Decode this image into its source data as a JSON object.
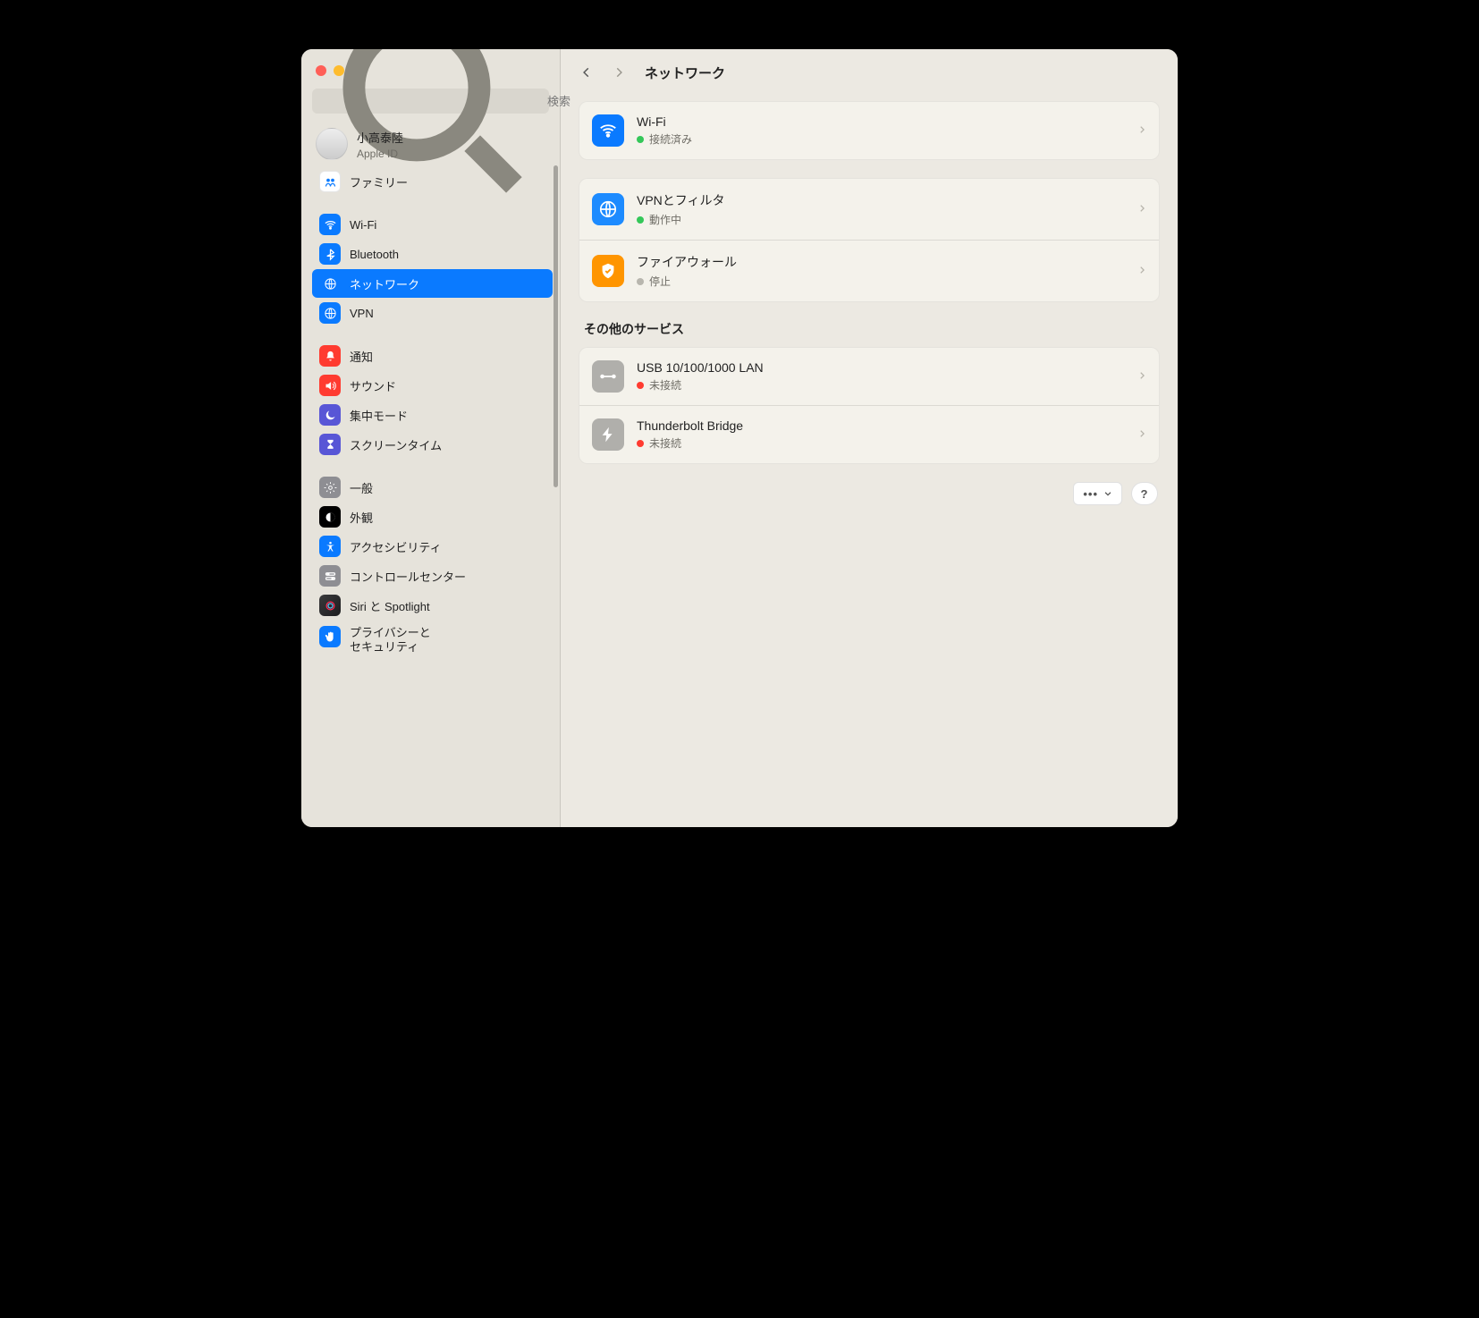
{
  "search": {
    "placeholder": "検索"
  },
  "account": {
    "name": "小高泰陸",
    "sub": "Apple ID"
  },
  "sidebar": {
    "family": "ファミリー",
    "group1": [
      {
        "label": "Wi-Fi"
      },
      {
        "label": "Bluetooth"
      },
      {
        "label": "ネットワーク"
      },
      {
        "label": "VPN"
      }
    ],
    "group2": [
      {
        "label": "通知"
      },
      {
        "label": "サウンド"
      },
      {
        "label": "集中モード"
      },
      {
        "label": "スクリーンタイム"
      }
    ],
    "group3": [
      {
        "label": "一般"
      },
      {
        "label": "外観"
      },
      {
        "label": "アクセシビリティ"
      },
      {
        "label": "コントロールセンター"
      },
      {
        "label": "Siri と Spotlight"
      },
      {
        "label": "プライバシーと\nセキュリティ"
      }
    ]
  },
  "page": {
    "title": "ネットワーク"
  },
  "primary": [
    {
      "title": "Wi-Fi",
      "status": "接続済み",
      "dot": "green"
    },
    {
      "title": "VPNとフィルタ",
      "status": "動作中",
      "dot": "green"
    },
    {
      "title": "ファイアウォール",
      "status": "停止",
      "dot": "grey"
    }
  ],
  "other_header": "その他のサービス",
  "other": [
    {
      "title": "USB 10/100/1000 LAN",
      "status": "未接続",
      "dot": "red"
    },
    {
      "title": "Thunderbolt Bridge",
      "status": "未接続",
      "dot": "red"
    }
  ],
  "footer": {
    "more": "•••",
    "help": "?"
  }
}
